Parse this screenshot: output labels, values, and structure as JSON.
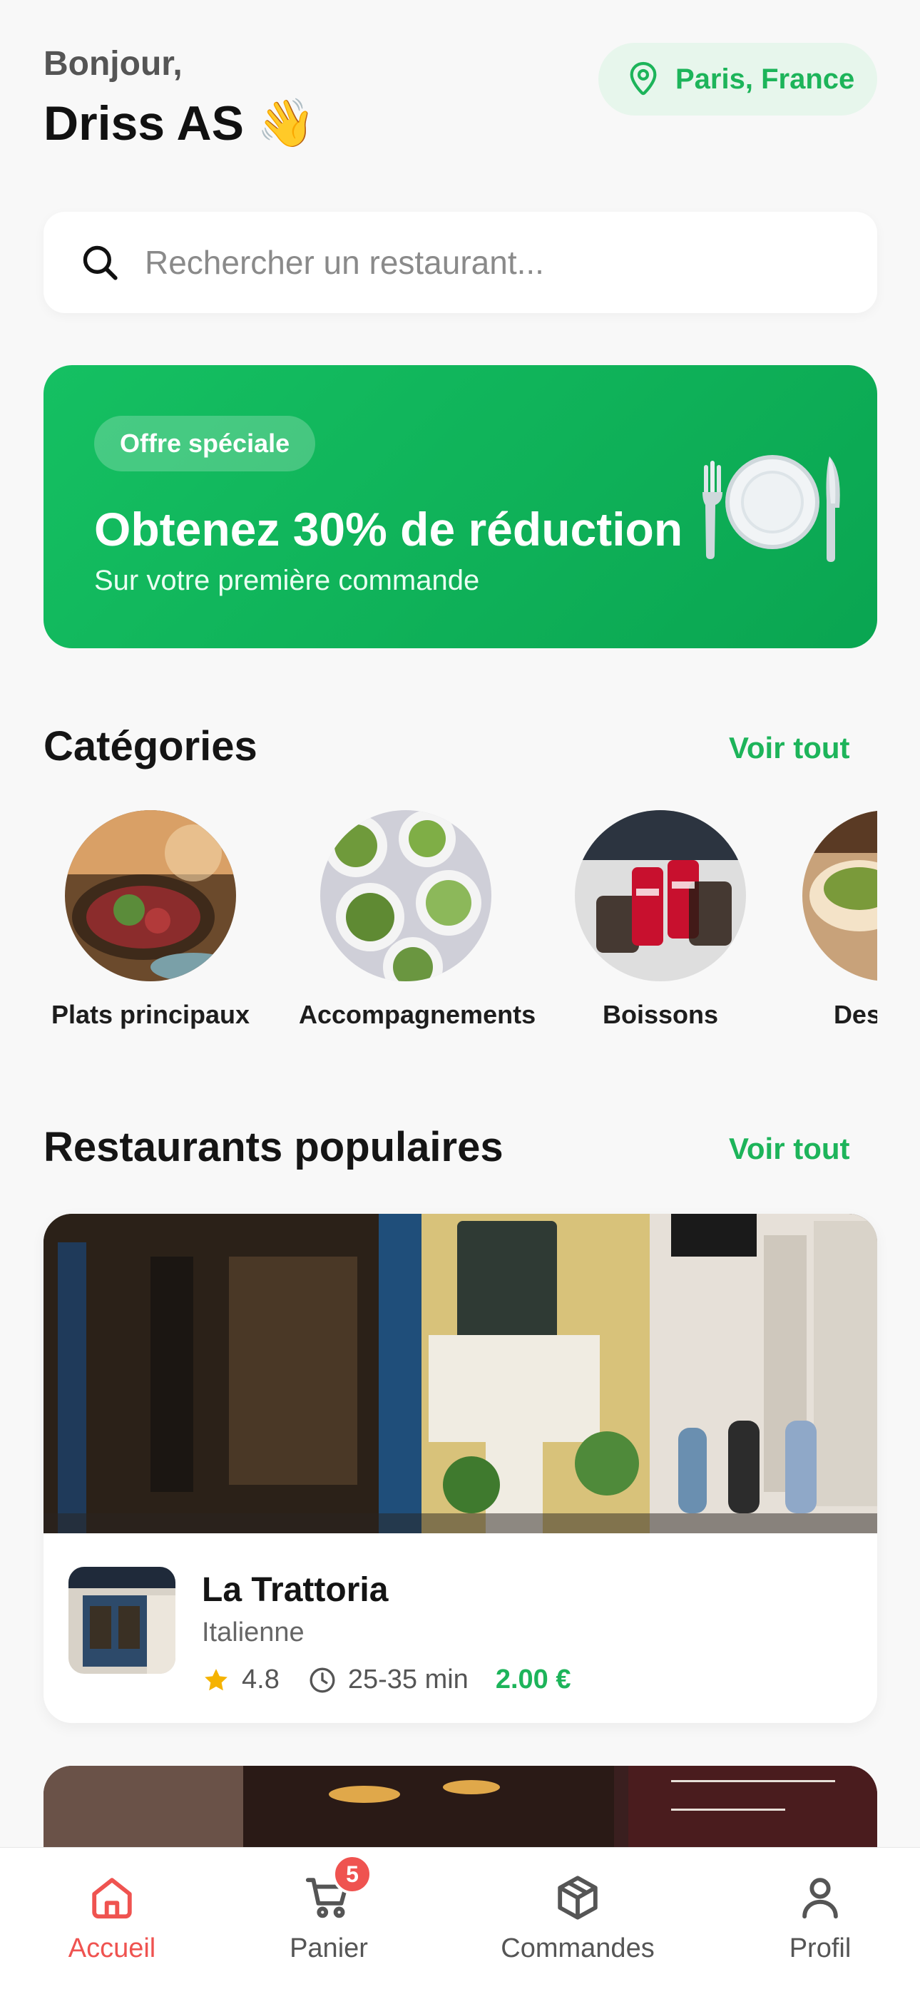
{
  "header": {
    "greeting": "Bonjour,",
    "user_name": "Driss AS",
    "wave_emoji": "👋",
    "location": "Paris, France"
  },
  "search": {
    "placeholder": "Rechercher un restaurant..."
  },
  "promo": {
    "tag": "Offre spéciale",
    "title": "Obtenez 30% de réduction",
    "subtitle": "Sur votre première commande"
  },
  "categories": {
    "title": "Catégories",
    "see_all": "Voir tout",
    "items": [
      {
        "label": "Plats principaux"
      },
      {
        "label": "Accompagnements"
      },
      {
        "label": "Boissons"
      },
      {
        "label": "Desserts"
      }
    ]
  },
  "popular": {
    "title": "Restaurants populaires",
    "see_all": "Voir tout",
    "restaurants": [
      {
        "name": "La Trattoria",
        "cuisine": "Italienne",
        "rating": "4.8",
        "delivery_time": "25-35 min",
        "price": "2.00 €"
      }
    ]
  },
  "tabbar": {
    "cart_badge": "5",
    "tabs": [
      {
        "label": "Accueil",
        "icon": "home-icon",
        "active": true
      },
      {
        "label": "Panier",
        "icon": "cart-icon",
        "active": false
      },
      {
        "label": "Commandes",
        "icon": "box-icon",
        "active": false
      },
      {
        "label": "Profil",
        "icon": "user-icon",
        "active": false
      }
    ]
  },
  "colors": {
    "accent": "#1db45a",
    "active_tab": "#ef5350",
    "promo_bg": "#12b35b"
  }
}
